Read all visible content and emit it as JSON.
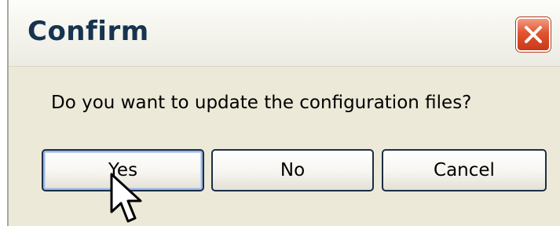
{
  "window": {
    "title": "Confirm"
  },
  "dialog": {
    "message": "Do you want to update the configuration files?"
  },
  "buttons": {
    "yes_label": "Yes",
    "no_label": "No",
    "cancel_label": "Cancel",
    "default": "yes"
  },
  "icons": {
    "close": "close-icon",
    "cursor": "mouse-pointer-icon"
  },
  "colors": {
    "title_text": "#16334f",
    "close_button": "#e0542f",
    "dialog_background": "#ece9d8",
    "button_border": "#1c2e46"
  }
}
